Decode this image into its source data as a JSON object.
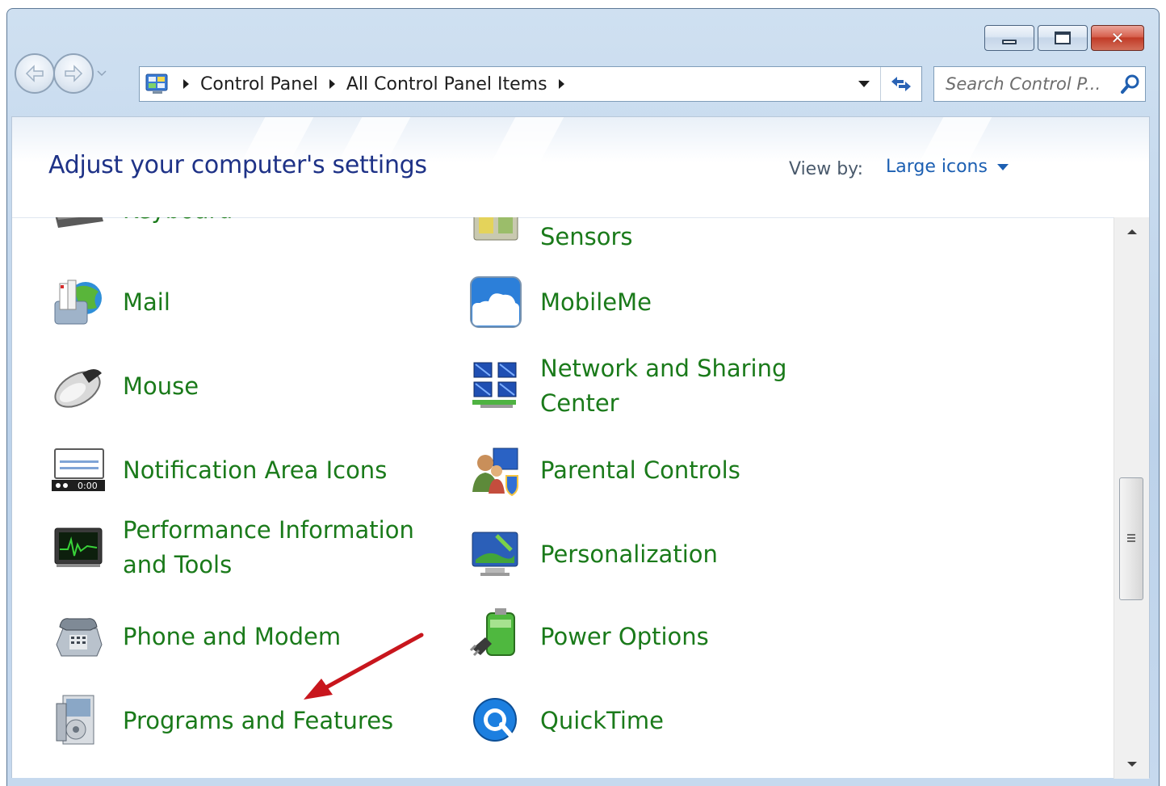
{
  "window": {
    "caption_buttons": {
      "minimize": "minimize",
      "maximize": "maximize",
      "close": "close"
    }
  },
  "address": {
    "breadcrumbs": [
      "Control Panel",
      "All Control Panel Items"
    ]
  },
  "search": {
    "placeholder": "Search Control P..."
  },
  "header": {
    "title": "Adjust your computer's settings",
    "view_by_label": "View by:",
    "view_by_value": "Large icons"
  },
  "items": [
    {
      "label": "Keyboard",
      "icon": "keyboard-icon"
    },
    {
      "label": "Sensors",
      "icon": "sensors-icon"
    },
    {
      "label": "Mail",
      "icon": "mail-icon"
    },
    {
      "label": "MobileMe",
      "icon": "mobileme-icon"
    },
    {
      "label": "Mouse",
      "icon": "mouse-icon"
    },
    {
      "label": "Network and Sharing\nCenter",
      "icon": "network-icon"
    },
    {
      "label": "Notification Area Icons",
      "icon": "notification-icon"
    },
    {
      "label": "Parental Controls",
      "icon": "parental-controls-icon"
    },
    {
      "label": "Performance Information\nand Tools",
      "icon": "performance-icon"
    },
    {
      "label": "Personalization",
      "icon": "personalization-icon"
    },
    {
      "label": "Phone and Modem",
      "icon": "phone-icon"
    },
    {
      "label": "Power Options",
      "icon": "power-icon"
    },
    {
      "label": "Programs and Features",
      "icon": "programs-icon"
    },
    {
      "label": "QuickTime",
      "icon": "quicktime-icon"
    }
  ],
  "colors": {
    "item_text": "#1a7a1a",
    "title_text": "#1e3287",
    "link_blue": "#1c5fb2",
    "annotation_arrow": "#c8161d"
  }
}
